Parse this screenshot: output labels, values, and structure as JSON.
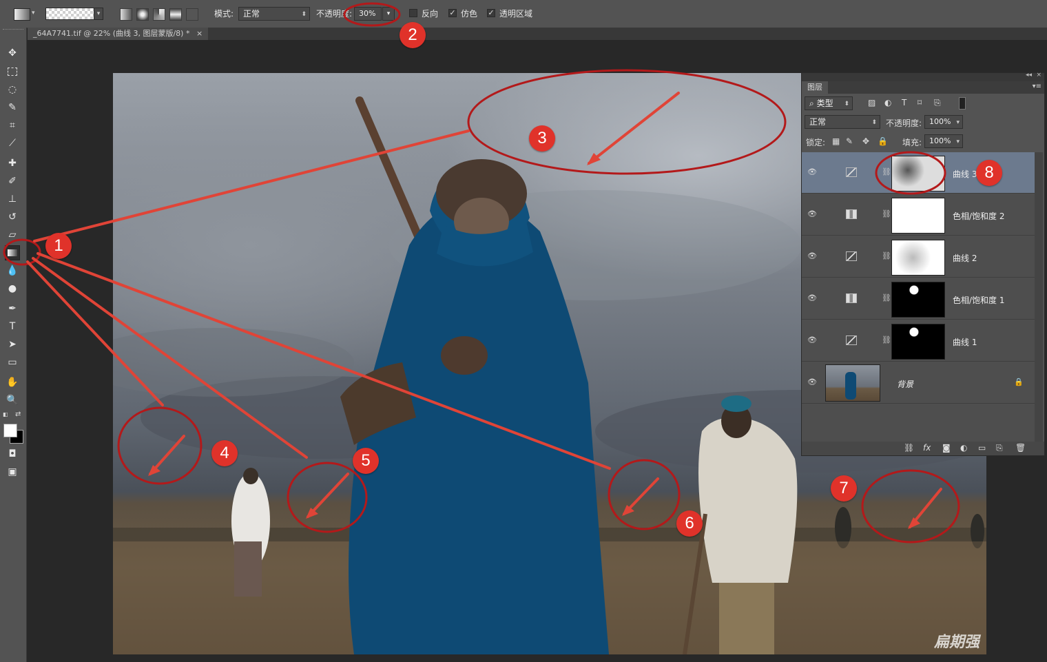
{
  "options_bar": {
    "mode_label": "模式:",
    "mode_value": "正常",
    "opacity_label": "不透明度:",
    "opacity_value": "30%",
    "reverse_label": "反向",
    "reverse_checked": false,
    "dither_label": "仿色",
    "dither_checked": true,
    "transparency_label": "透明区域",
    "transparency_checked": true
  },
  "document_tab": {
    "title": "_64A7741.tif @ 22% (曲线 3, 图层蒙版/8) *",
    "close": "×"
  },
  "tools": [
    "move-tool",
    "marquee-tool",
    "lasso-tool",
    "quick-select-tool",
    "crop-tool",
    "eyedropper-tool",
    "healing-brush-tool",
    "brush-tool",
    "clone-stamp-tool",
    "history-brush-tool",
    "eraser-tool",
    "gradient-tool",
    "blur-tool",
    "dodge-tool",
    "pen-tool",
    "type-tool",
    "path-select-tool",
    "shape-tool",
    "hand-tool",
    "zoom-tool"
  ],
  "layers_panel": {
    "title": "图层",
    "filter_label": "类型",
    "blend_mode": "正常",
    "opacity_label": "不透明度:",
    "opacity_value": "100%",
    "lock_label": "锁定:",
    "fill_label": "填充:",
    "fill_value": "100%",
    "layers": [
      {
        "name": "曲线 3",
        "type": "curves",
        "selected": true
      },
      {
        "name": "色相/饱和度 2",
        "type": "hue-saturation",
        "selected": false
      },
      {
        "name": "曲线 2",
        "type": "curves",
        "selected": false
      },
      {
        "name": "色相/饱和度 1",
        "type": "hue-saturation",
        "selected": false
      },
      {
        "name": "曲线 1",
        "type": "curves",
        "selected": false
      },
      {
        "name": "背景",
        "type": "background",
        "selected": false,
        "locked": true
      }
    ]
  },
  "annotations": [
    "1",
    "2",
    "3",
    "4",
    "5",
    "6",
    "7",
    "8"
  ],
  "colors": {
    "annotation_red": "#e0322a",
    "selected_layer": "#6c7a8e",
    "ui_gray": "#535353"
  },
  "watermark": "扁期强"
}
